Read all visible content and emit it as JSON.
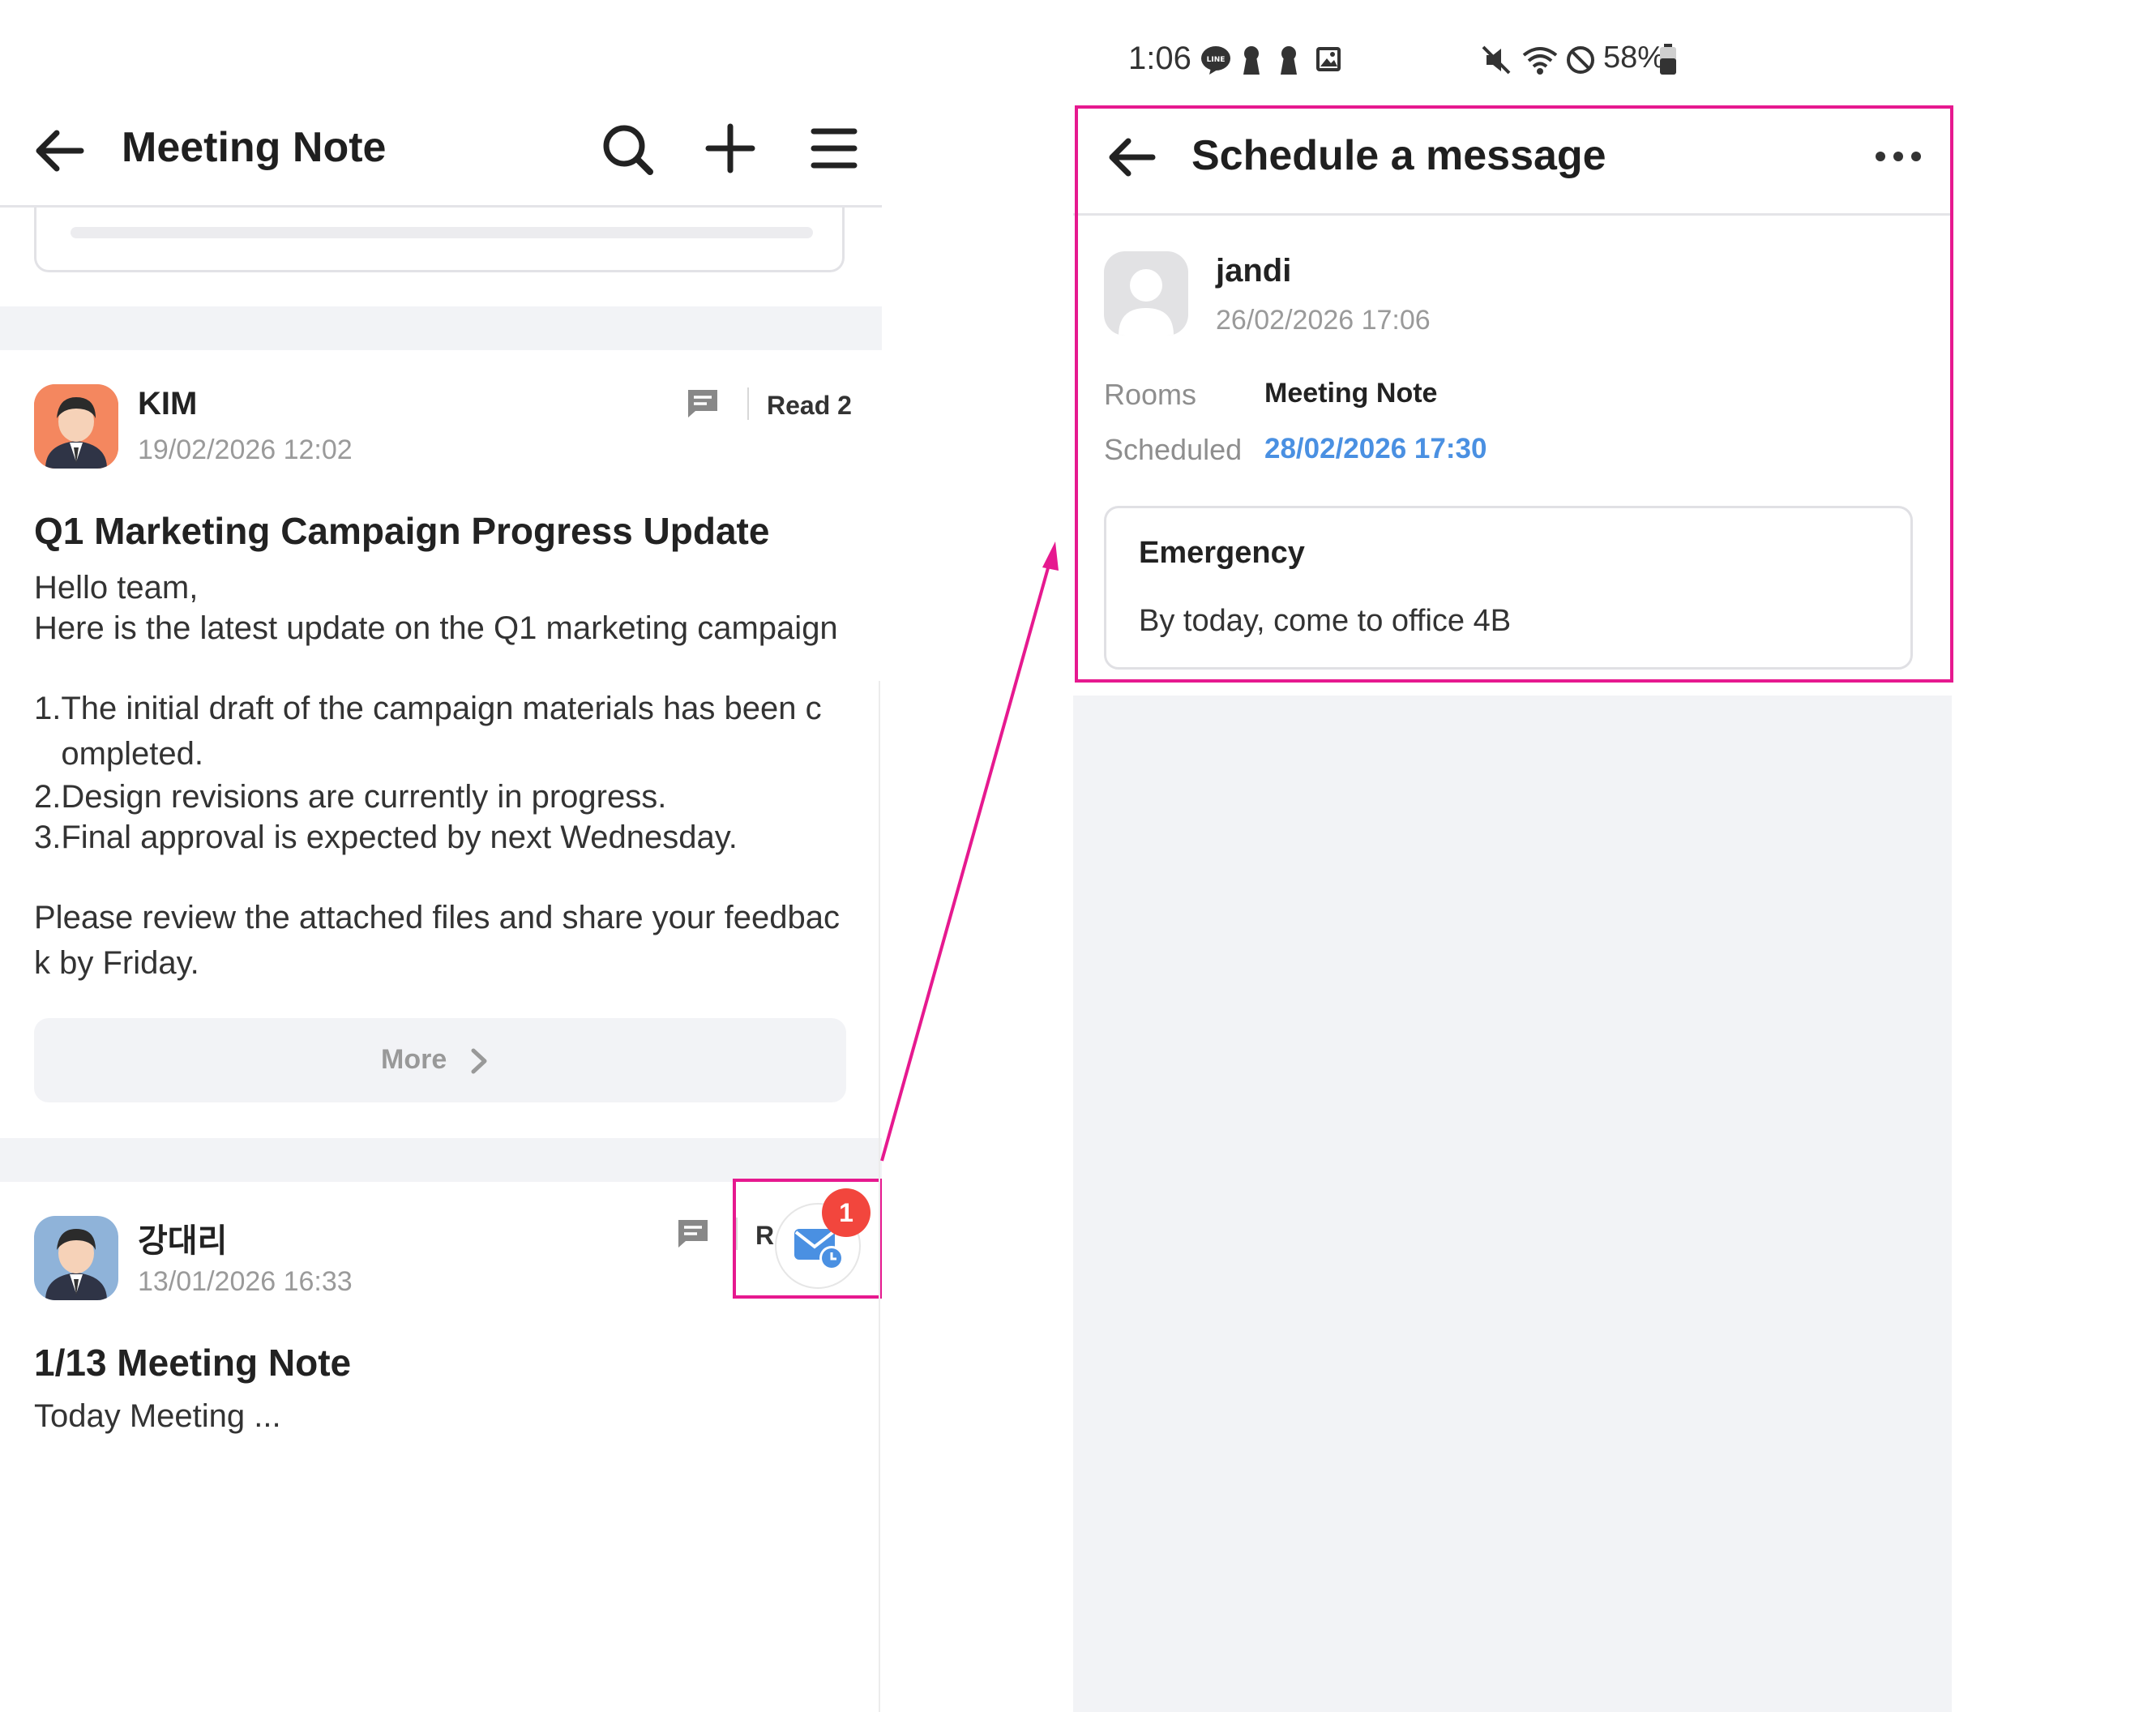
{
  "left": {
    "header": {
      "title": "Meeting Note"
    },
    "posts": [
      {
        "author": "KIM",
        "date": "19/02/2026 12:02",
        "read": "Read 2",
        "title": "Q1 Marketing Campaign Progress Update",
        "body": [
          "Hello team,",
          "Here is the latest update on the Q1 marketing campaign",
          "",
          "1.The initial draft of the campaign materials has been c",
          "   ompleted.",
          "2.Design revisions are currently in progress.",
          "3.Final approval is expected by next Wednesday.",
          "",
          "Please review the attached files and share your feedbac",
          "k by Friday."
        ],
        "more_label": "More"
      },
      {
        "author": "강대리",
        "date": "13/01/2026 16:33",
        "read_partial": "R",
        "title": "1/13 Meeting Note",
        "preview": "Today Meeting ..."
      }
    ],
    "scheduled_badge_count": "1"
  },
  "status_bar": {
    "time": "1:06",
    "battery": "58%"
  },
  "right": {
    "header": {
      "title": "Schedule a message"
    },
    "sender": {
      "name": "jandi",
      "date": "26/02/2026 17:06"
    },
    "rooms_label": "Rooms",
    "rooms_value": "Meeting Note",
    "scheduled_label": "Scheduled",
    "scheduled_value": "28/02/2026 17:30",
    "message": {
      "title": "Emergency",
      "body": "By today, come to office 4B"
    }
  },
  "colors": {
    "accent_pink": "#e6198f",
    "link_blue": "#4a90e2",
    "badge_red": "#f2463d"
  }
}
